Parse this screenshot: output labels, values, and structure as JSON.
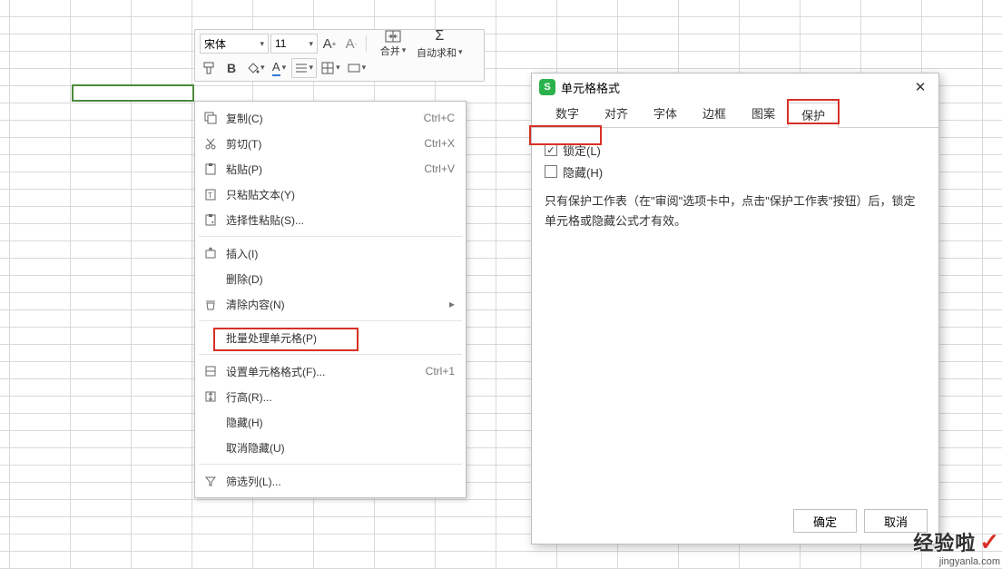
{
  "toolbar": {
    "font": "宋体",
    "size": "11",
    "merge_label": "合并",
    "autosum_label": "自动求和"
  },
  "context_menu": {
    "copy": {
      "label": "复制(C)",
      "shortcut": "Ctrl+C"
    },
    "cut": {
      "label": "剪切(T)",
      "shortcut": "Ctrl+X"
    },
    "paste": {
      "label": "粘贴(P)",
      "shortcut": "Ctrl+V"
    },
    "paste_text": {
      "label": "只粘贴文本(Y)"
    },
    "paste_special": {
      "label": "选择性粘贴(S)..."
    },
    "insert": {
      "label": "插入(I)"
    },
    "delete": {
      "label": "删除(D)"
    },
    "clear": {
      "label": "清除内容(N)"
    },
    "batch": {
      "label": "批量处理单元格(P)"
    },
    "format": {
      "label": "设置单元格格式(F)...",
      "shortcut": "Ctrl+1"
    },
    "row_height": {
      "label": "行高(R)..."
    },
    "hide": {
      "label": "隐藏(H)"
    },
    "unhide": {
      "label": "取消隐藏(U)"
    },
    "filter": {
      "label": "筛选列(L)..."
    }
  },
  "dialog": {
    "title": "单元格格式",
    "tabs": {
      "number": "数字",
      "align": "对齐",
      "font": "字体",
      "border": "边框",
      "pattern": "图案",
      "protect": "保护"
    },
    "lock_label": "锁定(L)",
    "hide_label": "隐藏(H)",
    "note": "只有保护工作表（在\"审阅\"选项卡中，点击\"保护工作表\"按钮）后，锁定单元格或隐藏公式才有效。",
    "ok": "确定",
    "cancel": "取消"
  },
  "watermark": {
    "main": "经验啦",
    "sub": "jingyanla.com"
  }
}
